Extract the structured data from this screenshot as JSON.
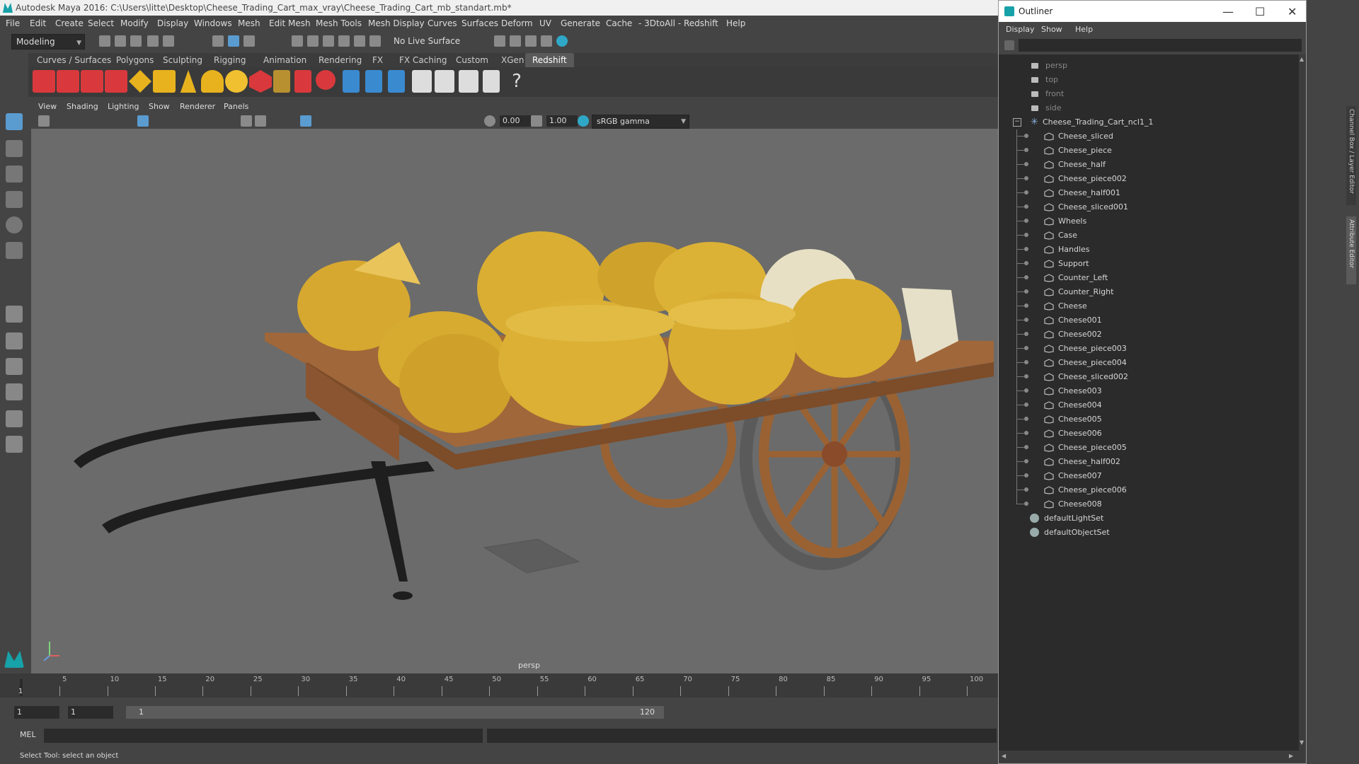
{
  "window": {
    "title": "Autodesk Maya 2016: C:\\Users\\litte\\Desktop\\Cheese_Trading_Cart_max_vray\\Cheese_Trading_Cart_mb_standart.mb*"
  },
  "menubar": [
    "File",
    "Edit",
    "Create",
    "Select",
    "Modify",
    "Display",
    "Windows",
    "Mesh",
    "Edit Mesh",
    "Mesh Tools",
    "Mesh Display",
    "Curves",
    "Surfaces",
    "Deform",
    "UV",
    "Generate",
    "Cache",
    "- 3DtoAll -",
    "Redshift",
    "Help"
  ],
  "status": {
    "mode": "Modeling",
    "live_surface": "No Live Surface"
  },
  "shelf_tabs": [
    "Curves / Surfaces",
    "Polygons",
    "Sculpting",
    "Rigging",
    "Animation",
    "Rendering",
    "FX",
    "FX Caching",
    "Custom",
    "XGen",
    "Redshift"
  ],
  "shelf_active_tab": "Redshift",
  "panel_menu": [
    "View",
    "Shading",
    "Lighting",
    "Show",
    "Renderer",
    "Panels"
  ],
  "panel_toolbar": {
    "exposure": "0.00",
    "gamma": "1.00",
    "colorspace": "sRGB gamma"
  },
  "viewport": {
    "camera_label": "persp"
  },
  "timeline": {
    "ticks": [
      "5",
      "10",
      "15",
      "20",
      "25",
      "30",
      "35",
      "40",
      "45",
      "50",
      "55",
      "60",
      "65",
      "70",
      "75",
      "80",
      "85",
      "90",
      "95",
      "100"
    ],
    "current_frame": "1"
  },
  "range": {
    "start": "1",
    "playback_start": "1",
    "slider_value": "1",
    "end": "120"
  },
  "mel": {
    "label": "MEL"
  },
  "helpline": "Select Tool: select an object",
  "outliner": {
    "title": "Outliner",
    "menus": [
      "Display",
      "Show",
      "Help"
    ],
    "cameras": [
      "persp",
      "top",
      "front",
      "side"
    ],
    "group": "Cheese_Trading_Cart_ncl1_1",
    "children": [
      "Cheese_sliced",
      "Cheese_piece",
      "Cheese_half",
      "Cheese_piece002",
      "Cheese_half001",
      "Cheese_sliced001",
      "Wheels",
      "Case",
      "Handles",
      "Support",
      "Counter_Left",
      "Counter_Right",
      "Cheese",
      "Cheese001",
      "Cheese002",
      "Cheese_piece003",
      "Cheese_piece004",
      "Cheese_sliced002",
      "Cheese003",
      "Cheese004",
      "Cheese005",
      "Cheese006",
      "Cheese_piece005",
      "Cheese_half002",
      "Cheese007",
      "Cheese_piece006",
      "Cheese008"
    ],
    "sets": [
      "defaultLightSet",
      "defaultObjectSet"
    ]
  },
  "side_tabs": {
    "channel_box": "Channel Box / Layer Editor",
    "attribute_editor": "Attribute Editor"
  },
  "colors": {
    "accent": "#17a1a8",
    "cheese": "#e0b43a",
    "wood": "#9a6233",
    "viewport_bg": "#6b6b6b"
  }
}
